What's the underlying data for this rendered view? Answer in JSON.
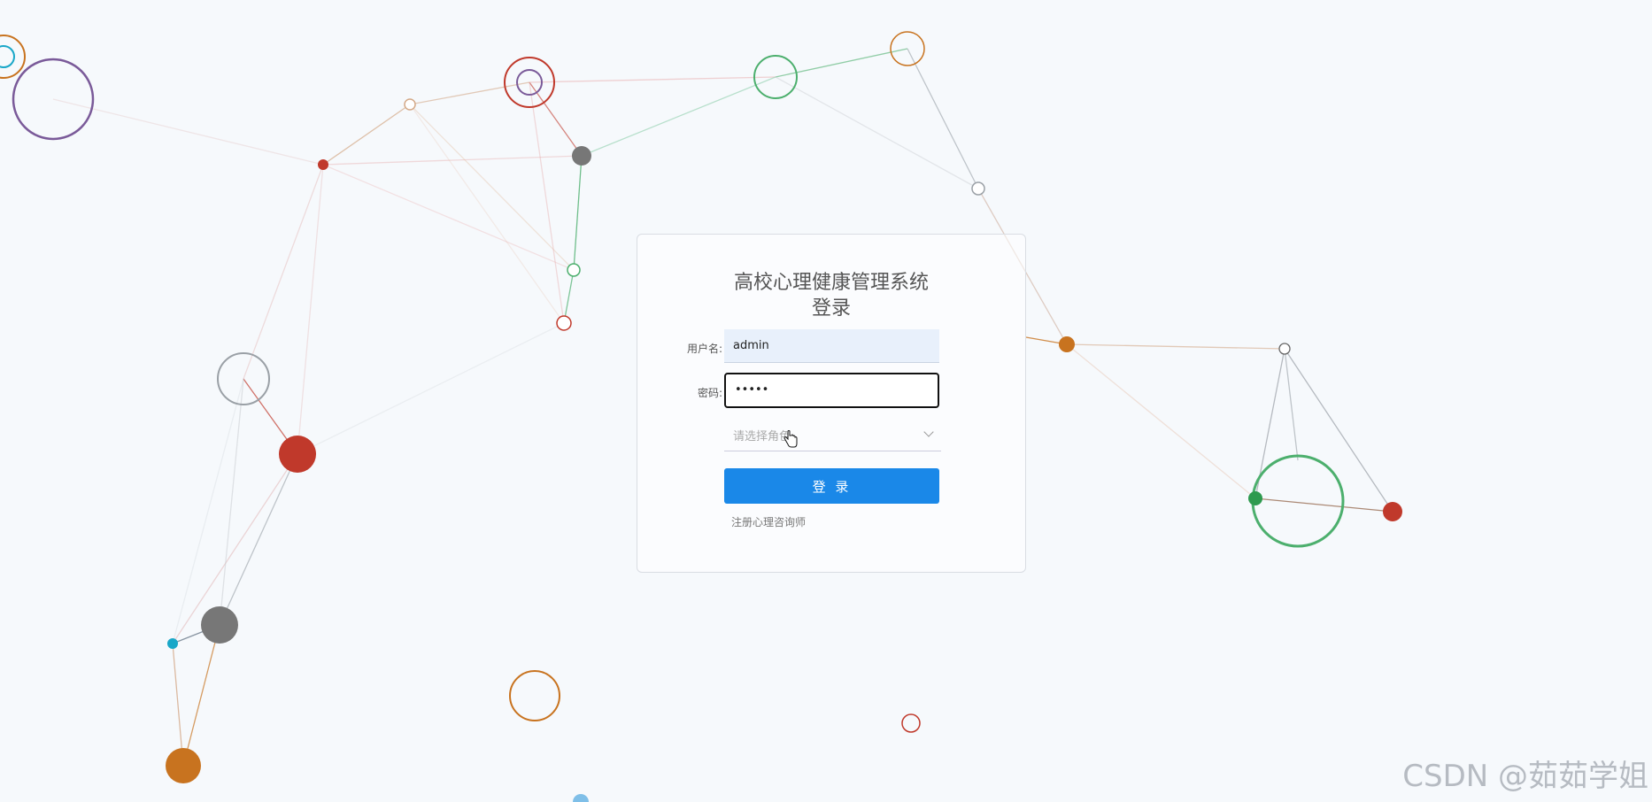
{
  "login": {
    "title_line1": "高校心理健康管理系统",
    "title_line2": "登录",
    "username_label": "用户名:",
    "username_value": "admin",
    "password_label": "密码:",
    "password_masked": "•••••",
    "role_placeholder": "请选择角色",
    "submit_label": "登 录",
    "register_link": "注册心理咨询师"
  },
  "watermark": "CSDN @茹茹学姐",
  "colors": {
    "primary": "#1a88e8",
    "background": "#f6f9fc",
    "orange": "#c8731f",
    "red": "#c0392b",
    "green": "#4caf6d",
    "purple": "#7a5a99",
    "gray": "#777777",
    "teal": "#19a7c8"
  }
}
